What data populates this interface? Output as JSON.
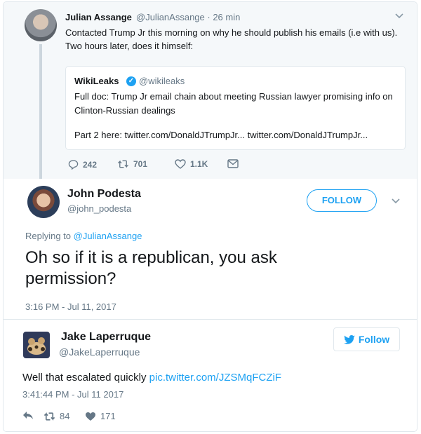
{
  "quoted_thread": {
    "author": {
      "name": "Julian Assange",
      "handle": "@JulianAssange",
      "time": "· 26 min"
    },
    "text": "Contacted Trump Jr this morning on why he should publish his emails (i.e with us). Two hours later, does it himself:",
    "quote": {
      "name": "WikiLeaks",
      "handle": "@wikileaks",
      "text": "Full doc: Trump Jr email chain about meeting Russian lawyer promising info on Clinton-Russian dealings",
      "part2": "Part 2 here: twitter.com/DonaldJTrumpJr... twitter.com/DonaldJTrumpJr..."
    },
    "actions": {
      "replies": "242",
      "retweets": "701",
      "likes": "1.1K"
    }
  },
  "main_tweet": {
    "author": {
      "name": "John Podesta",
      "handle": "@john_podesta"
    },
    "follow_label": "FOLLOW",
    "replying_prefix": "Replying to",
    "replying_to": "@JulianAssange",
    "text": "Oh so if it is a republican, you ask permission?",
    "timestamp": "3:16 PM - Jul 11, 2017"
  },
  "outer_tweet": {
    "author": {
      "name": "Jake Laperruque",
      "handle": "@JakeLaperruque"
    },
    "follow_label": "Follow",
    "text": "Well that escalated quickly",
    "link": "pic.twitter.com/JZSMqFCZiF",
    "timestamp": "3:41:44 PM - Jul 11 2017",
    "retweets": "84",
    "likes": "171"
  },
  "colors": {
    "accent": "#1da1f2",
    "muted": "#657786",
    "text": "#14171a",
    "border": "#e1e8ed"
  }
}
